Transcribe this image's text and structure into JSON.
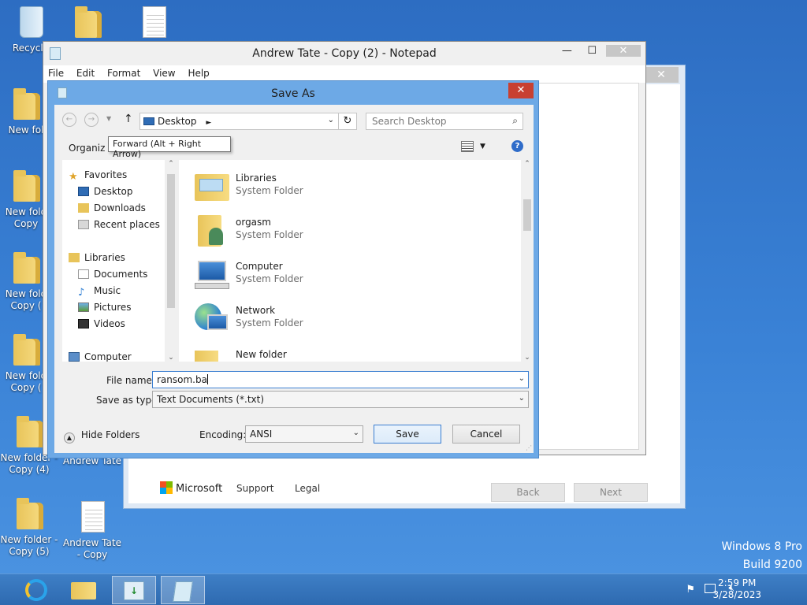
{
  "desktop": {
    "icons": [
      {
        "label": "Recycle"
      },
      {
        "label": ""
      },
      {
        "label": ""
      },
      {
        "label": "New fol"
      },
      {
        "label": "New fold"
      },
      {
        "label": "Copy"
      },
      {
        "label": "New fold"
      },
      {
        "label": "Copy ("
      },
      {
        "label": "New fold"
      },
      {
        "label": "Copy ("
      },
      {
        "label": "New folder -"
      },
      {
        "label": "Copy (4)"
      },
      {
        "label": "Andrew Tate"
      },
      {
        "label": "New folder -"
      },
      {
        "label": "Copy (5)"
      },
      {
        "label": "Andrew Tate"
      },
      {
        "label": "- Copy"
      }
    ],
    "watermark": {
      "line1": "Windows 8 Pro",
      "line2": "Build 9200"
    }
  },
  "setup_window": {
    "close": "✕",
    "footer": {
      "brand": "Microsoft",
      "support": "Support",
      "legal": "Legal",
      "back": "Back",
      "next": "Next"
    }
  },
  "notepad": {
    "title": "Andrew Tate - Copy (2) - Notepad",
    "menu": [
      "File",
      "Edit",
      "Format",
      "View",
      "Help"
    ],
    "controls": {
      "min": "—",
      "max": "☐",
      "close": "✕"
    }
  },
  "save_dialog": {
    "title": "Save As",
    "close": "✕",
    "address": {
      "location": "Desktop"
    },
    "search": {
      "placeholder": "Search Desktop"
    },
    "toolbar": {
      "organize": "Organiz"
    },
    "tooltip": "Forward (Alt + Right Arrow)",
    "nav": {
      "favorites": "Favorites",
      "desktop": "Desktop",
      "downloads": "Downloads",
      "recent": "Recent places",
      "libraries": "Libraries",
      "documents": "Documents",
      "music": "Music",
      "pictures": "Pictures",
      "videos": "Videos",
      "computer": "Computer"
    },
    "files": [
      {
        "name": "Libraries",
        "type": "System Folder"
      },
      {
        "name": "orgasm",
        "type": "System Folder"
      },
      {
        "name": "Computer",
        "type": "System Folder"
      },
      {
        "name": "Network",
        "type": "System Folder"
      },
      {
        "name": "New folder",
        "type": ""
      }
    ],
    "form": {
      "file_name_label": "File name:",
      "file_name_value": "ransom.ba",
      "type_label": "Save as type:",
      "type_value": "Text Documents (*.txt)",
      "encoding_label": "Encoding:",
      "encoding_value": "ANSI",
      "hide_folders": "Hide Folders",
      "save": "Save",
      "cancel": "Cancel"
    }
  },
  "taskbar": {
    "clock": {
      "time": "2:59 PM",
      "date": "3/28/2023"
    }
  },
  "colors": {
    "accent": "#6da9e6",
    "desktop": "#2f71c6",
    "close_red": "#c84031"
  }
}
